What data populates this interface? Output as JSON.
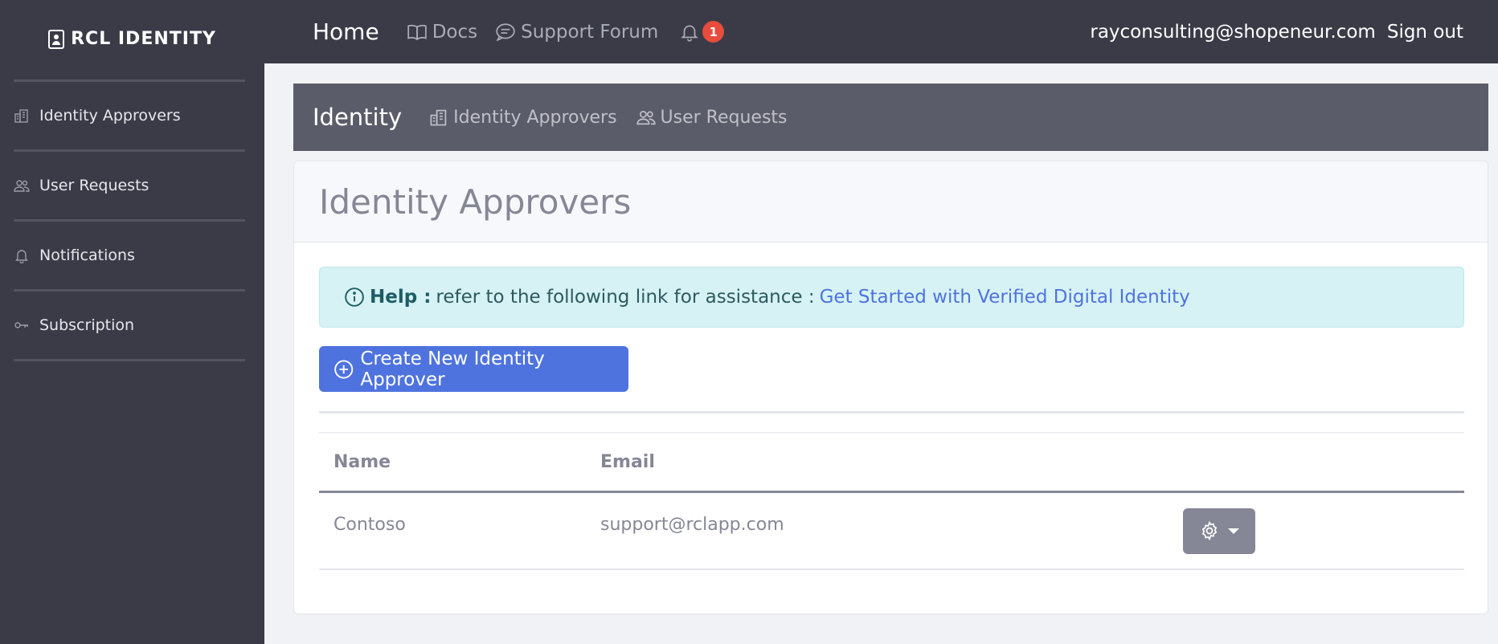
{
  "brand": {
    "title": "RCL IDENTITY"
  },
  "sidebar": {
    "items": [
      {
        "label": "Identity Approvers",
        "icon": "building-icon"
      },
      {
        "label": "User Requests",
        "icon": "users-icon"
      },
      {
        "label": "Notifications",
        "icon": "bell-icon"
      },
      {
        "label": "Subscription",
        "icon": "key-icon"
      }
    ]
  },
  "topbar": {
    "home": "Home",
    "docs": "Docs",
    "support": "Support Forum",
    "notification_count": "1",
    "email": "rayconsulting@shopeneur.com",
    "signout": "Sign out"
  },
  "subheader": {
    "title": "Identity",
    "links": [
      {
        "label": "Identity Approvers",
        "icon": "building-icon"
      },
      {
        "label": "User Requests",
        "icon": "users-icon"
      }
    ]
  },
  "page": {
    "title": "Identity Approvers",
    "help": {
      "label": "Help :",
      "text": "refer to the following link for assistance :",
      "link": "Get Started with Verified Digital Identity"
    },
    "create_button": "Create New Identity Approver"
  },
  "table": {
    "columns": [
      "Name",
      "Email"
    ],
    "rows": [
      {
        "name": "Contoso",
        "email": "support@rclapp.com"
      }
    ]
  },
  "colors": {
    "sidebar_bg": "#3a3b47",
    "subheader_bg": "#5b5c69",
    "primary": "#4e73df",
    "info_bg": "#d7f2f4",
    "badge": "#e74c3c",
    "secondary": "#858796"
  }
}
